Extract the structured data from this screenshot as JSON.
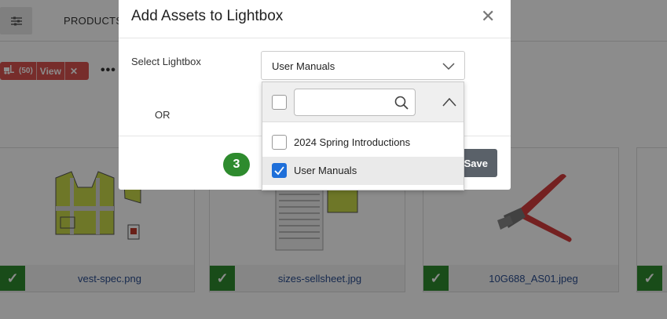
{
  "background": {
    "filter_icon": "sliders-icon",
    "products_tab": "PRODUCTS",
    "lightbox_pill": {
      "icon": "forklift-icon",
      "count": "(50)",
      "view_label": "View",
      "close_glyph": "✕",
      "color": "#d9534f"
    },
    "more_glyph": "•••",
    "cards": [
      {
        "name": "vest-spec.png",
        "checked": true
      },
      {
        "name": "sizes-sellsheet.jpg",
        "checked": true
      },
      {
        "name": "10G688_AS01.jpeg",
        "checked": true
      },
      {
        "name": "",
        "checked": true
      }
    ]
  },
  "modal": {
    "title": "Add Assets to Lightbox",
    "close_glyph": "✕",
    "select_label": "Select Lightbox",
    "select_value": "User Manuals",
    "or_label": "OR",
    "save_label": "Save",
    "step_badge": "3",
    "dropdown": {
      "search_value": "",
      "options": [
        {
          "label": "2024 Spring Introductions",
          "checked": false
        },
        {
          "label": "User Manuals",
          "checked": true
        }
      ]
    }
  },
  "colors": {
    "accent_green": "#2e8b2e",
    "checkbox_blue": "#1e6fd9",
    "save_button": "#5a6169"
  }
}
